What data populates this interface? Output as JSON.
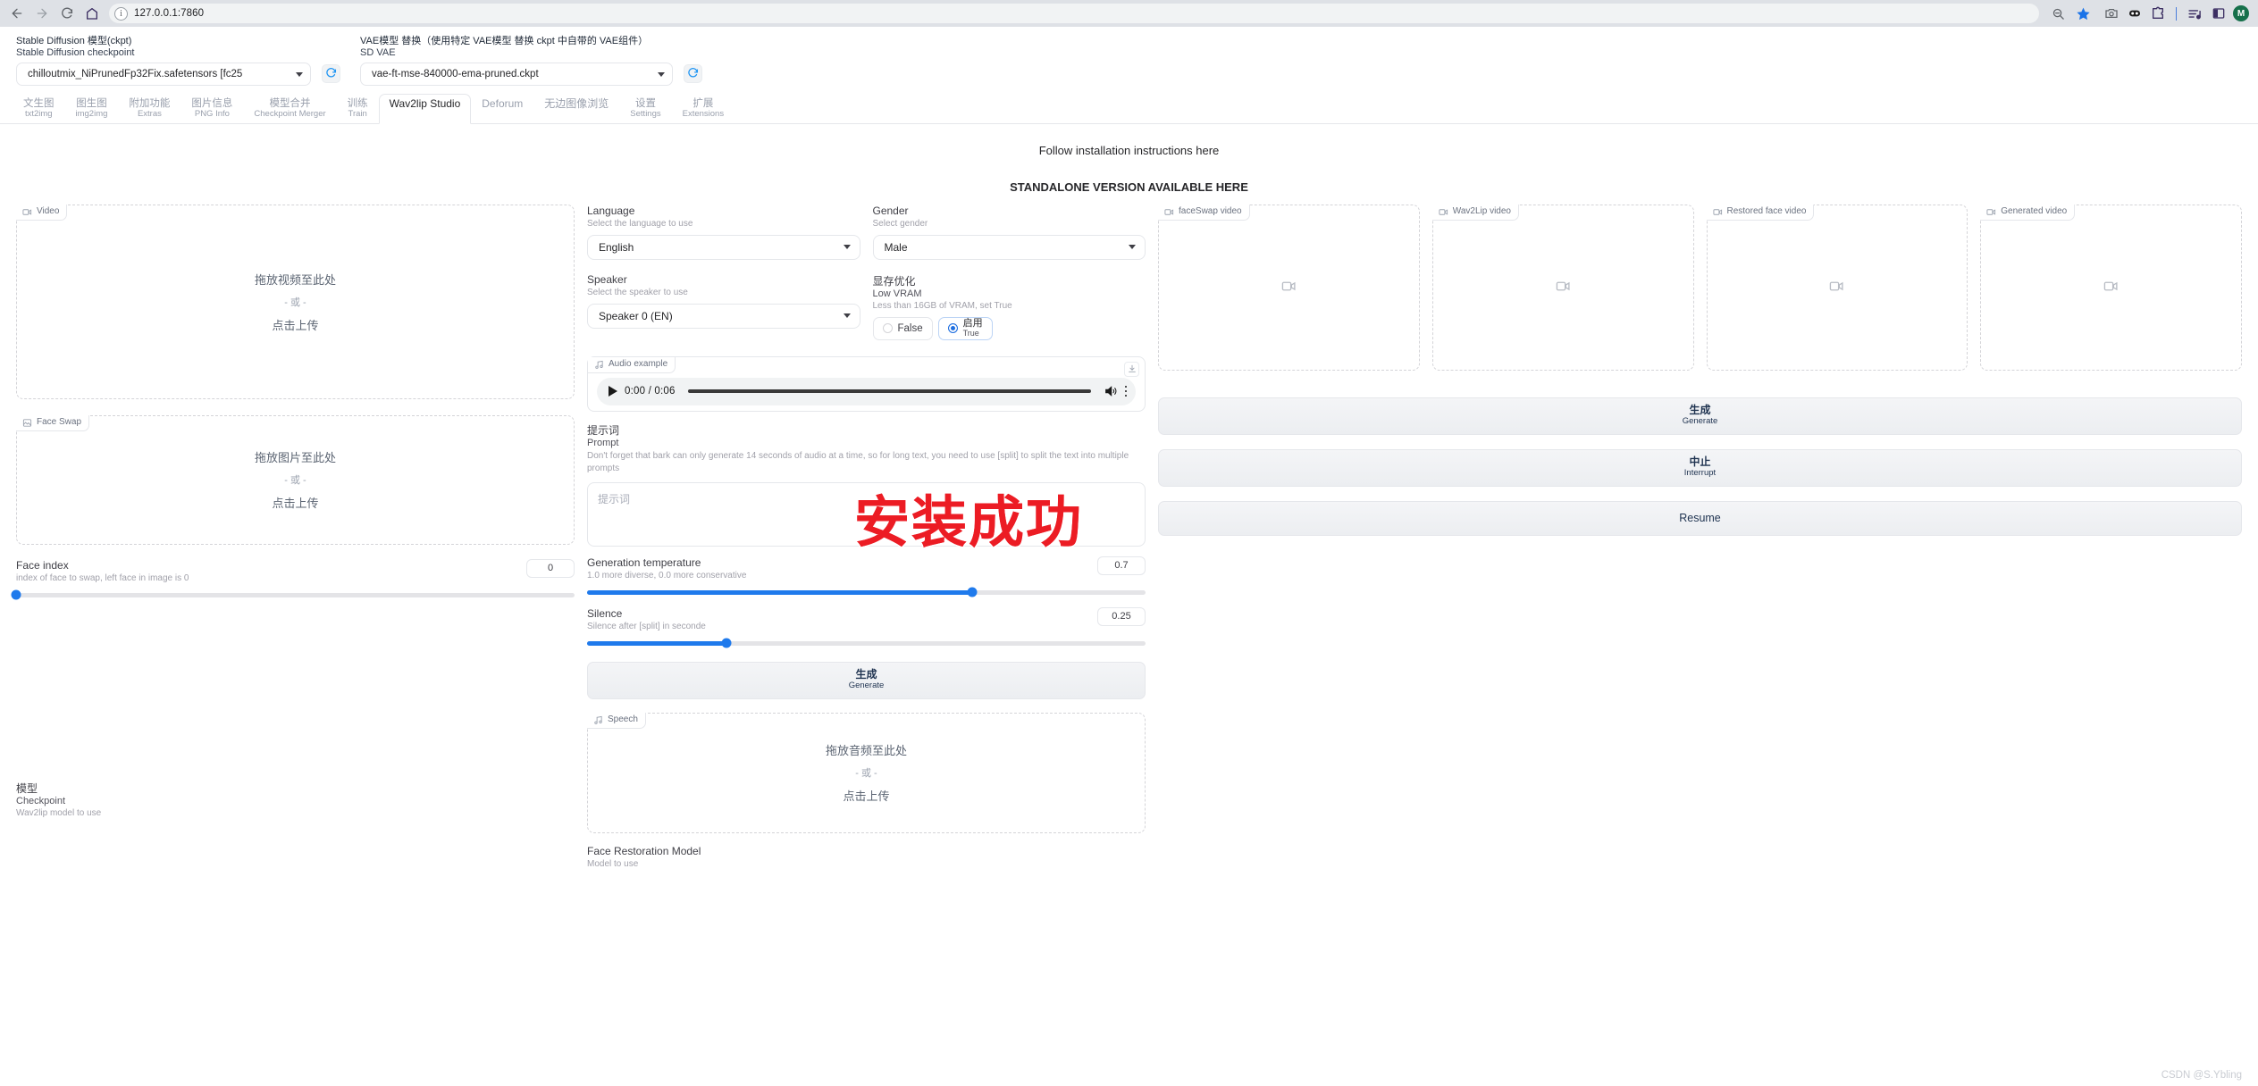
{
  "browser": {
    "url": "127.0.0.1:7860",
    "back_tooltip": "Back",
    "forward_tooltip": "Forward",
    "reload_tooltip": "Reload",
    "home_tooltip": "Home",
    "avatar_initial": "M"
  },
  "sd_topbar": {
    "checkpoint": {
      "label_zh": "Stable Diffusion 模型(ckpt)",
      "label_en": "Stable Diffusion checkpoint",
      "value": "chilloutmix_NiPrunedFp32Fix.safetensors [fc25"
    },
    "vae": {
      "label_zh": "VAE模型 替换（使用特定 VAE模型 替换 ckpt 中自带的 VAE组件）",
      "label_en": "SD VAE",
      "value": "vae-ft-mse-840000-ema-pruned.ckpt"
    }
  },
  "tabs": [
    {
      "zh": "文生图",
      "en": "txt2img",
      "active": false
    },
    {
      "zh": "图生图",
      "en": "img2img",
      "active": false
    },
    {
      "zh": "附加功能",
      "en": "Extras",
      "active": false
    },
    {
      "zh": "图片信息",
      "en": "PNG Info",
      "active": false
    },
    {
      "zh": "模型合并",
      "en": "Checkpoint Merger",
      "active": false
    },
    {
      "zh": "训练",
      "en": "Train",
      "active": false
    },
    {
      "zh": "Wav2lip Studio",
      "en": "",
      "active": true
    },
    {
      "zh": "Deforum",
      "en": "",
      "active": false
    },
    {
      "zh": "无边图像浏览",
      "en": "",
      "active": false
    },
    {
      "zh": "设置",
      "en": "Settings",
      "active": false
    },
    {
      "zh": "扩展",
      "en": "Extensions",
      "active": false
    }
  ],
  "banner": {
    "line1": "Follow installation instructions here",
    "line2": "STANDALONE VERSION AVAILABLE HERE"
  },
  "left": {
    "video_block_label": "Video",
    "video_drop_main": "拖放视频至此处",
    "video_drop_or": "- 或 -",
    "video_drop_click": "点击上传",
    "faceswap_block_label": "Face Swap",
    "image_drop_main": "拖放图片至此处",
    "image_drop_or": "- 或 -",
    "image_drop_click": "点击上传",
    "face_index": {
      "name": "Face index",
      "desc": "index of face to swap, left face in image is 0",
      "value": "0",
      "fill_pct": 0
    },
    "checkpoint": {
      "label_zh": "模型",
      "label_en": "Checkpoint",
      "desc": "Wav2lip model to use"
    }
  },
  "middle": {
    "language": {
      "label": "Language",
      "desc": "Select the language to use",
      "value": "English"
    },
    "gender": {
      "label": "Gender",
      "desc": "Select gender",
      "value": "Male"
    },
    "speaker": {
      "label": "Speaker",
      "desc": "Select the speaker to use",
      "value": "Speaker 0 (EN)"
    },
    "low_vram": {
      "label_zh": "显存优化",
      "label_en": "Low VRAM",
      "desc": "Less than 16GB of VRAM, set True",
      "option_false": "False",
      "option_true_zh": "启用",
      "option_true_en": "True",
      "selected": "True"
    },
    "audio_example": {
      "block_label": "Audio example",
      "time": "0:00 / 0:06"
    },
    "prompt": {
      "label_zh": "提示词",
      "label_en": "Prompt",
      "desc": "Don't forget that bark can only generate 14 seconds of audio at a time, so for long text, you need to use [split] to split the text into multiple prompts",
      "placeholder_zh": "提示词",
      "placeholder_en": "Prompt",
      "value": ""
    },
    "generation_temperature": {
      "name": "Generation temperature",
      "desc": "1.0 more diverse, 0.0 more conservative",
      "value": "0.7",
      "fill_pct": 69
    },
    "silence": {
      "name": "Silence",
      "desc": "Silence after [split] in seconde",
      "value": "0.25",
      "fill_pct": 25
    },
    "generate_button": {
      "zh": "生成",
      "en": "Generate"
    },
    "speech_block_label": "Speech",
    "audio_drop_main": "拖放音频至此处",
    "audio_drop_or": "- 或 -",
    "audio_drop_click": "点击上传",
    "face_restoration": {
      "label": "Face Restoration Model",
      "desc": "Model to use"
    }
  },
  "right": {
    "videos": [
      {
        "label": "faceSwap video"
      },
      {
        "label": "Wav2Lip video"
      },
      {
        "label": "Restored face video"
      },
      {
        "label": "Generated video"
      }
    ],
    "buttons": [
      {
        "zh": "生成",
        "en": "Generate",
        "single": false
      },
      {
        "zh": "中止",
        "en": "Interrupt",
        "single": false
      },
      {
        "zh": "Resume",
        "en": "",
        "single": true
      }
    ]
  },
  "overlays": {
    "red_watermark": "安装成功",
    "csdn": "CSDN @S.Ybling"
  },
  "colors": {
    "accent_blue": "#1f7aec",
    "refresh_blue": "#2196f3",
    "watermark_red": "#ec1c24",
    "browser_chrome": "#dee1e6"
  }
}
